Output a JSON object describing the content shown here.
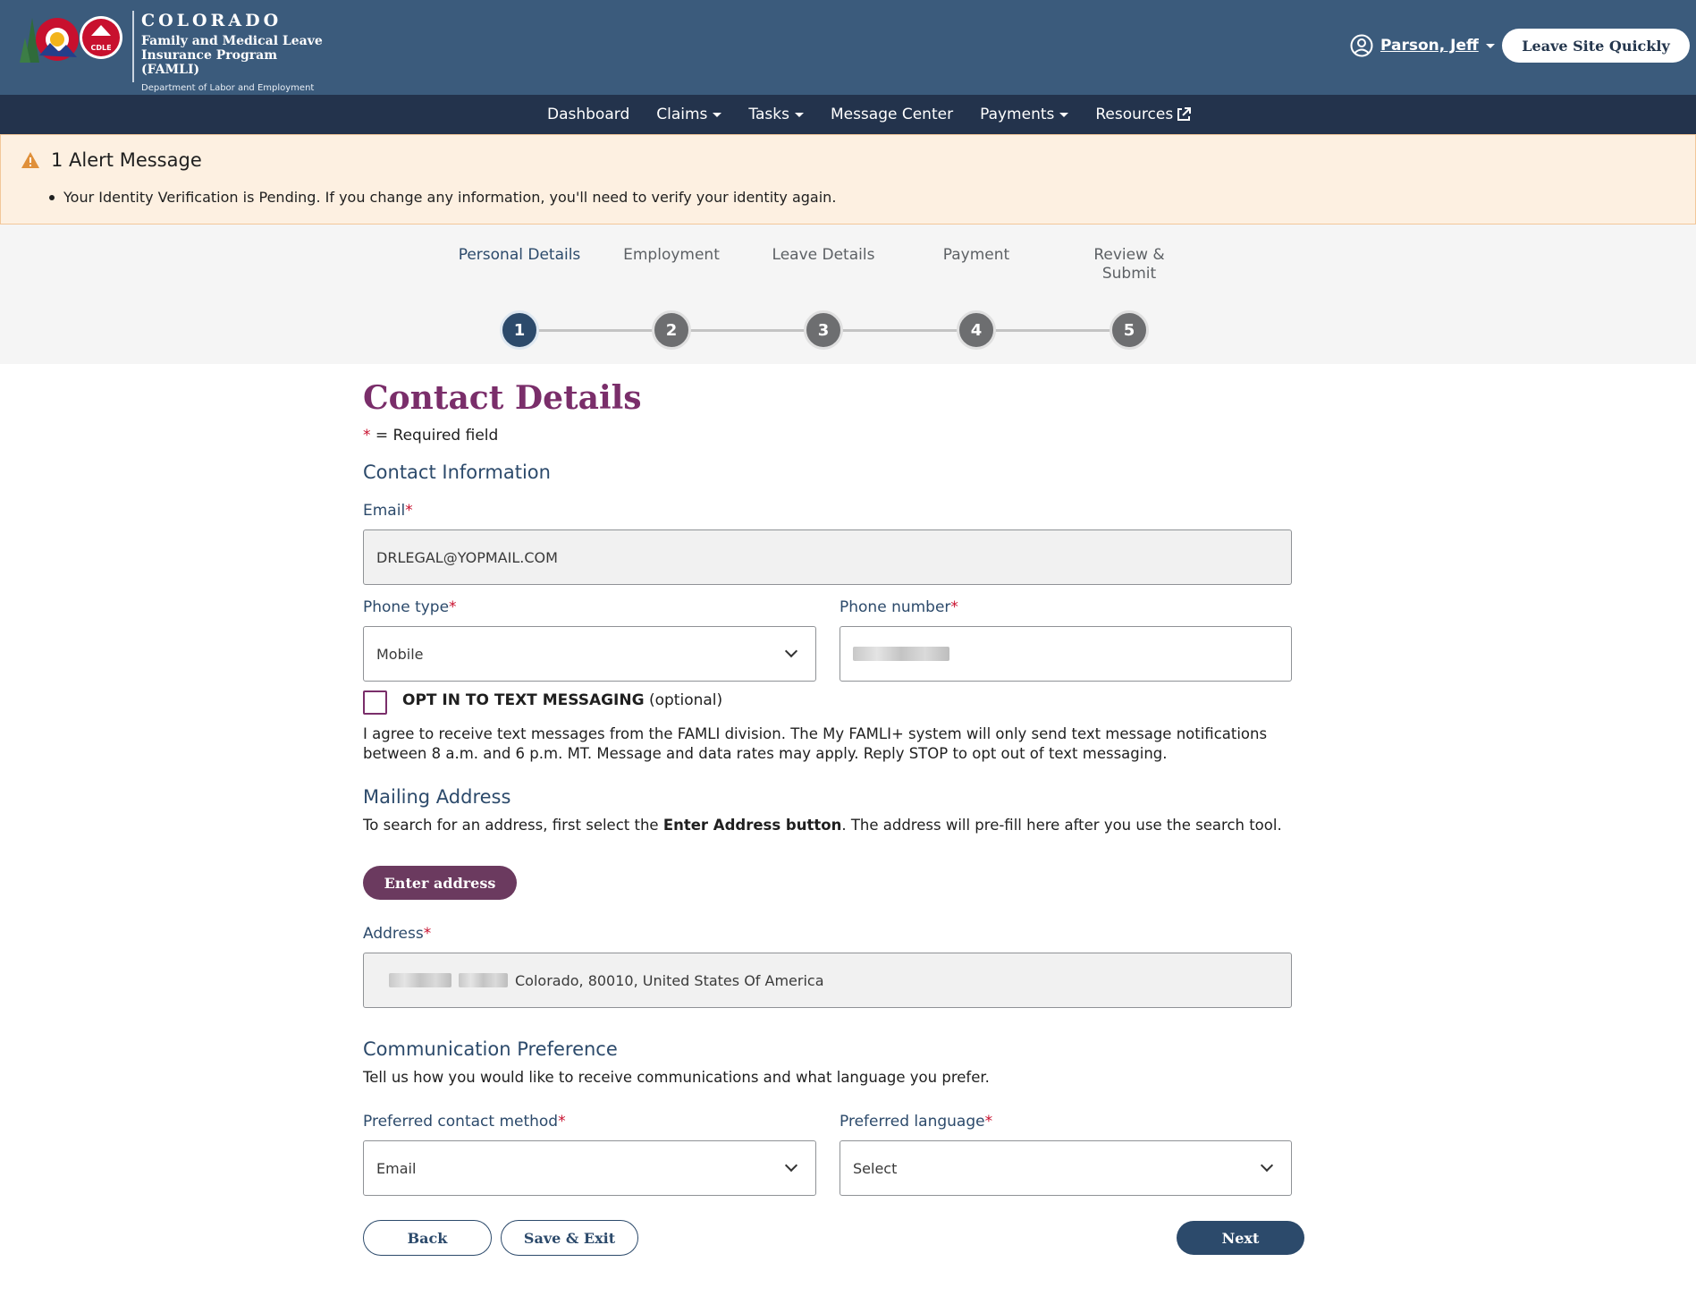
{
  "header": {
    "brand_title": "COLORADO",
    "brand_line1": "Family and Medical Leave",
    "brand_line2": "Insurance Program (FAMLI)",
    "brand_dept": "Department of Labor and Employment",
    "logo_badge": "CDLE",
    "user_name": "Parson, Jeff",
    "leave_site_label": "Leave Site Quickly"
  },
  "nav": {
    "dashboard": "Dashboard",
    "claims": "Claims",
    "tasks": "Tasks",
    "message_center": "Message Center",
    "payments": "Payments",
    "resources": "Resources"
  },
  "alert": {
    "title": "1 Alert Message",
    "message": "Your Identity Verification is Pending. If you change any information, you'll need to verify your identity again."
  },
  "stepper": {
    "steps": [
      {
        "label": "Personal Details",
        "number": "1"
      },
      {
        "label": "Employment",
        "number": "2"
      },
      {
        "label": "Leave Details",
        "number": "3"
      },
      {
        "label": "Payment",
        "number": "4"
      },
      {
        "label": "Review & Submit",
        "number": "5"
      }
    ],
    "current_step": 1
  },
  "form": {
    "title": "Contact Details",
    "required_marker": "*",
    "required_note": "= Required field",
    "contact_section": "Contact Information",
    "email_label": "Email",
    "email_value": "DRLEGAL@YOPMAIL.COM",
    "phone_type_label": "Phone type",
    "phone_type_value": "Mobile",
    "phone_number_label": "Phone number",
    "opt_in_strong": "OPT IN TO TEXT MESSAGING",
    "opt_in_suffix": "(optional)",
    "opt_in_text": "I agree to receive text messages from the FAMLI division. The My FAMLI+ system will only send text message notifications between 8 a.m. and 6 p.m. MT. Message and data rates may apply. Reply STOP to opt out of text messaging.",
    "mailing_section": "Mailing Address",
    "mailing_text_1": "To search for an address, first select the",
    "mailing_text_strong": "Enter Address button",
    "mailing_text_2": ". The address will pre-fill here after you use the search tool.",
    "enter_address_label": "Enter address",
    "address_label": "Address",
    "address_value": "Colorado, 80010, United States Of America",
    "comm_section": "Communication Preference",
    "comm_text": "Tell us how you would like to receive communications and what language you prefer.",
    "contact_method_label": "Preferred contact method",
    "contact_method_value": "Email",
    "language_label": "Preferred language",
    "language_value": "Select"
  },
  "actions": {
    "back": "Back",
    "save_exit": "Save & Exit",
    "next": "Next"
  },
  "colors": {
    "header_bg": "#3b5b7c",
    "nav_bg": "#23334c",
    "accent_purple": "#7a2e6a",
    "primary_navy": "#2c4a6b",
    "alert_bg": "#fdf0e1",
    "required_red": "#c8102e"
  }
}
